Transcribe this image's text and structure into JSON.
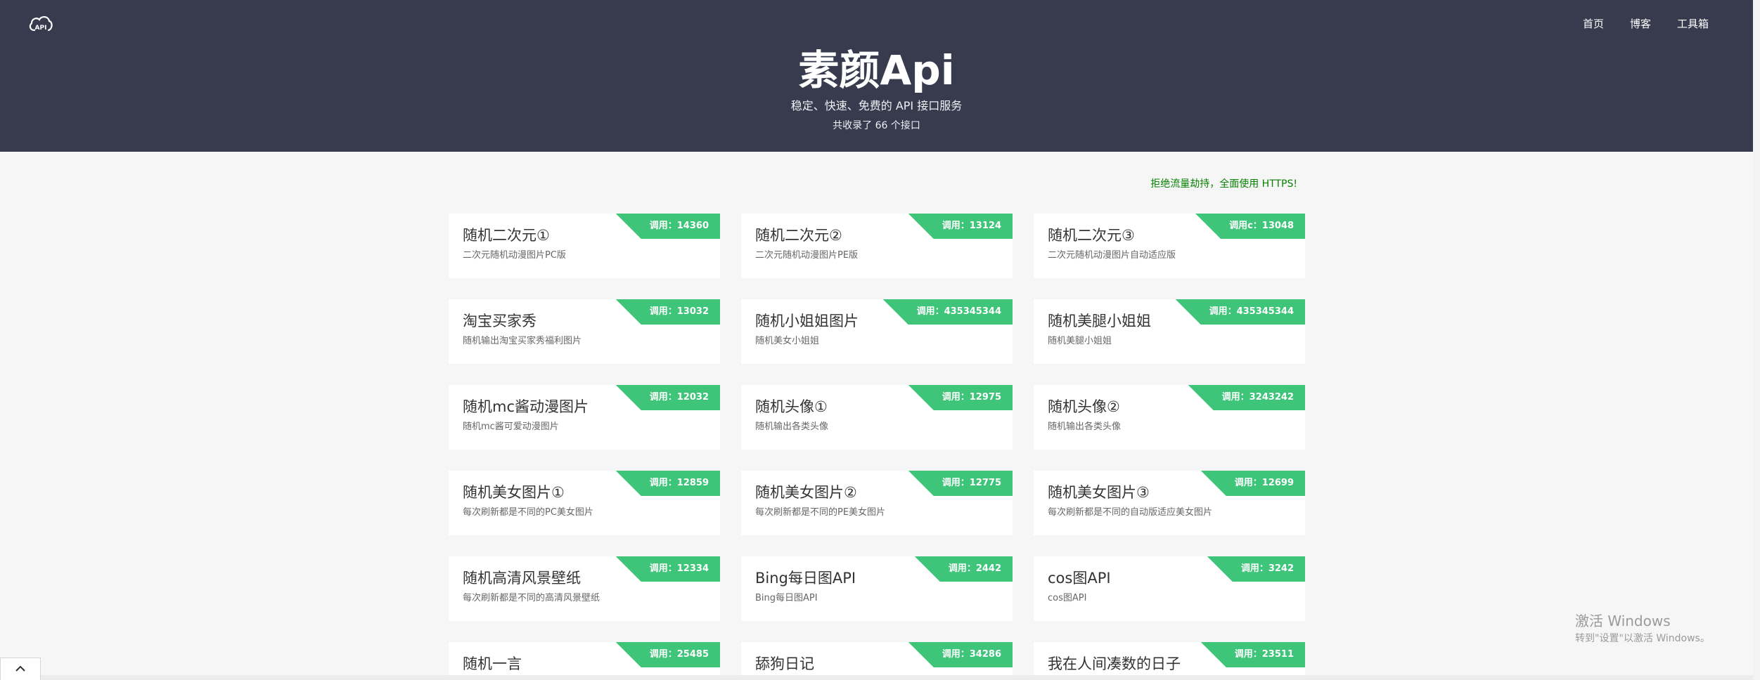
{
  "header": {
    "logo_text": "API",
    "nav": [
      "首页",
      "博客",
      "工具箱"
    ],
    "title": "素颜Api",
    "subtitle": "稳定、快速、免费的 API 接口服务",
    "count": "共收录了 66 个接口"
  },
  "notice": "拒绝流量劫持，全面使用 HTTPS!",
  "cards": [
    {
      "name": "随机二次元①",
      "desc": "二次元随机动漫图片PC版",
      "badge": "调用：14360"
    },
    {
      "name": "随机二次元②",
      "desc": "二次元随机动漫图片PE版",
      "badge": "调用：13124"
    },
    {
      "name": "随机二次元③",
      "desc": "二次元随机动漫图片自动适应版",
      "badge": "调用c：13048"
    },
    {
      "name": "淘宝买家秀",
      "desc": "随机输出淘宝买家秀福利图片",
      "badge": "调用：13032"
    },
    {
      "name": "随机小姐姐图片",
      "desc": "随机美女小姐姐",
      "badge": "调用：435345344"
    },
    {
      "name": "随机美腿小姐姐",
      "desc": "随机美腿小姐姐",
      "badge": "调用：435345344"
    },
    {
      "name": "随机mc酱动漫图片",
      "desc": "随机mc酱可爱动漫图片",
      "badge": "调用：12032"
    },
    {
      "name": "随机头像①",
      "desc": "随机输出各类头像",
      "badge": "调用：12975"
    },
    {
      "name": "随机头像②",
      "desc": "随机输出各类头像",
      "badge": "调用：3243242"
    },
    {
      "name": "随机美女图片①",
      "desc": "每次刷新都是不同的PC美女图片",
      "badge": "调用：12859"
    },
    {
      "name": "随机美女图片②",
      "desc": "每次刷新都是不同的PE美女图片",
      "badge": "调用：12775"
    },
    {
      "name": "随机美女图片③",
      "desc": "每次刷新都是不同的自动版适应美女图片",
      "badge": "调用：12699"
    },
    {
      "name": "随机高清风景壁纸",
      "desc": "每次刷新都是不同的高清风景壁纸",
      "badge": "调用：12334"
    },
    {
      "name": "Bing每日图API",
      "desc": "Bing每日图API",
      "badge": "调用：2442"
    },
    {
      "name": "cos图API",
      "desc": "cos图API",
      "badge": "调用：3242"
    },
    {
      "name": "随机一言",
      "desc": "",
      "badge": "调用：25485"
    },
    {
      "name": "舔狗日记",
      "desc": "",
      "badge": "调用：34286"
    },
    {
      "name": "我在人间凑数的日子",
      "desc": "",
      "badge": "调用：23511"
    }
  ],
  "watermark": {
    "line1": "激活 Windows",
    "line2": "转到\"设置\"以激活 Windows。"
  },
  "colors": {
    "header_bg": "#373b4d",
    "badge_bg": "#3ec57a",
    "notice": "#078100",
    "page_bg": "#f6f6f6"
  }
}
